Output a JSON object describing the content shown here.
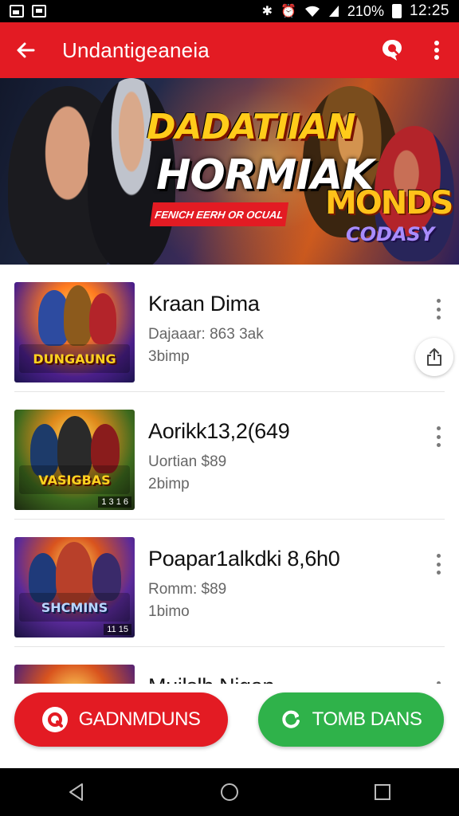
{
  "status_bar": {
    "battery": "210%",
    "time": "12:25"
  },
  "app_bar": {
    "title": "Undantigeaneia"
  },
  "banner": {
    "title_line1": "DADATIIAN",
    "title_line2": "HORMIAK",
    "subtitle": "FENICH EERH OR OCUAL",
    "logo_line1": "MONDS",
    "logo_line2": "CODASY"
  },
  "games": [
    {
      "name": "Kraan Dima",
      "meta_line1": "Dajaaar: 863 3ak",
      "meta_line2": "3bimp",
      "thumb_label": "DUNGAUNG",
      "thumb_badge": ""
    },
    {
      "name": "Aorikk13,2(649",
      "meta_line1": "Uortian $89",
      "meta_line2": "2bimp",
      "thumb_label": "VASIGBAS",
      "thumb_badge": "1 3 1 6"
    },
    {
      "name": "Poapar1alkdki 8,6h0",
      "meta_line1": "Romm: $89",
      "meta_line2": "1bimo",
      "thumb_label": "SHCMINS",
      "thumb_badge": "11 15"
    },
    {
      "name": "Mujlslh Nigan",
      "meta_line1": "",
      "meta_line2": "",
      "thumb_label": "",
      "thumb_badge": ""
    }
  ],
  "buttons": {
    "left_label": "GADNMDUNS",
    "right_label": "TOMB DANS"
  },
  "colors": {
    "primary_red": "#e31b23",
    "accent_green": "#2fb24a"
  },
  "icons": {
    "back": "arrow-left-icon",
    "search": "search-icon",
    "more": "more-vert-icon",
    "share": "share-icon",
    "nav_back": "triangle-back-icon",
    "nav_home": "circle-home-icon",
    "nav_recents": "square-recents-icon"
  }
}
